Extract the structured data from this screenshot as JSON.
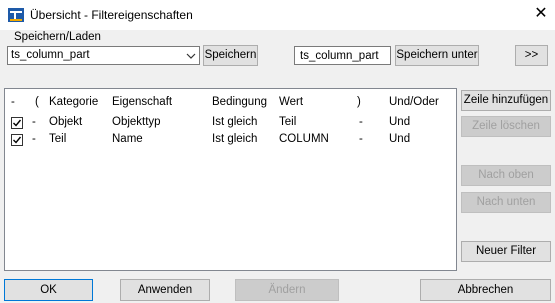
{
  "window": {
    "title": "Übersicht - Filtereigenschaften",
    "close_glyph": "✕",
    "close_icon": "close-icon",
    "app_icon": "tekla-app-icon"
  },
  "save_load": {
    "group_label": "Speichern/Laden",
    "combo_value": "ts_column_part",
    "save_label": "Speichern",
    "save_as_value": "ts_column_part",
    "save_as_label": "Speichern unter",
    "more_label": ">>"
  },
  "table": {
    "headers": [
      "-",
      "(",
      "Kategorie",
      "Eigenschaft",
      "Bedingung",
      "Wert",
      ")",
      "Und/Oder"
    ],
    "rows": [
      {
        "checked": true,
        "dash": "-",
        "open": "",
        "category": "Objekt",
        "property": "Objekttyp",
        "condition": "Ist gleich",
        "value": "Teil",
        "close": "-",
        "andor": "Und"
      },
      {
        "checked": true,
        "dash": "-",
        "open": "",
        "category": "Teil",
        "property": "Name",
        "condition": "Ist gleich",
        "value": "COLUMN",
        "close": "-",
        "andor": "Und"
      }
    ]
  },
  "side_buttons": {
    "add_row": "Zeile hinzufügen",
    "delete_row": "Zeile löschen",
    "move_up": "Nach oben",
    "move_down": "Nach unten",
    "new_filter": "Neuer Filter"
  },
  "footer": {
    "ok": "OK",
    "apply": "Anwenden",
    "modify": "Ändern",
    "cancel": "Abbrechen"
  },
  "colors": {
    "accent": "#0078d7",
    "border": "#adadad",
    "disabled_text": "#a0a0a0"
  }
}
